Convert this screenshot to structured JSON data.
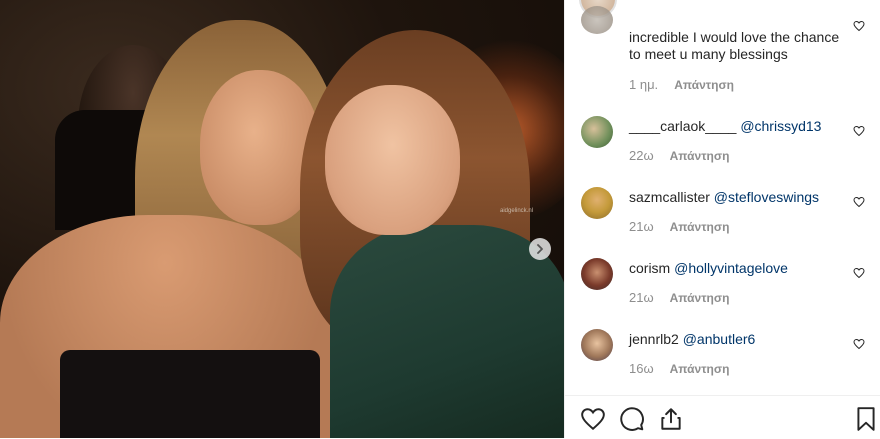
{
  "post_image": {
    "watermark": "aidgelinck.nl",
    "next_icon": "chevron-right-icon"
  },
  "comments": [
    {
      "username": "",
      "text": "incredible I would love the chance to meet u many blessings",
      "time": "1 ημ.",
      "reply_label": "Απάντηση"
    },
    {
      "username": "____carlaok____",
      "mention": "@chrissyd13",
      "time": "22ω",
      "reply_label": "Απάντηση"
    },
    {
      "username": "sazmcallister",
      "mention": "@stefloveswings",
      "time": "21ω",
      "reply_label": "Απάντηση"
    },
    {
      "username": "corism",
      "mention": "@hollyvintagelove",
      "time": "21ω",
      "reply_label": "Απάντηση"
    },
    {
      "username": "jennrlb2",
      "mention": "@anbutler6",
      "time": "16ω",
      "reply_label": "Απάντηση"
    }
  ],
  "actions": {
    "like_icon": "heart-icon",
    "comment_icon": "comment-icon",
    "share_icon": "share-icon",
    "save_icon": "bookmark-icon"
  }
}
